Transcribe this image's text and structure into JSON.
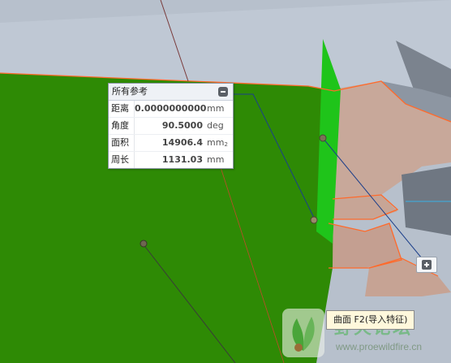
{
  "measure_panel": {
    "title": "所有参考",
    "collapse_icon": "collapse-icon",
    "rows": [
      {
        "label": "距离",
        "value": "0.0000000000",
        "unit": "mm",
        "unit_sup": ""
      },
      {
        "label": "角度",
        "value": "90.5000",
        "unit": "deg",
        "unit_sup": ""
      },
      {
        "label": "面积",
        "value": "14906.4",
        "unit": "mm",
        "unit_sup": "2"
      },
      {
        "label": "周长",
        "value": "1131.03",
        "unit": "mm",
        "unit_sup": ""
      }
    ]
  },
  "expand_button": {
    "icon": "expand-plus-icon"
  },
  "tooltip": {
    "text": "曲面 F2(导入特征)"
  },
  "watermark": {
    "text": "野火论坛",
    "url": "www.proewildfire.cn"
  },
  "colors": {
    "green_surface": "#2e8a05",
    "bright_green_face": "#1fc41a",
    "gray_model": "#b7c0cc",
    "pink_model": "#c8a89a",
    "dark_gray": "#7b838e",
    "orange_edge": "#ff6a2b",
    "red_annotation": "#e01010",
    "tooltip_bg": "#fff8dc"
  }
}
